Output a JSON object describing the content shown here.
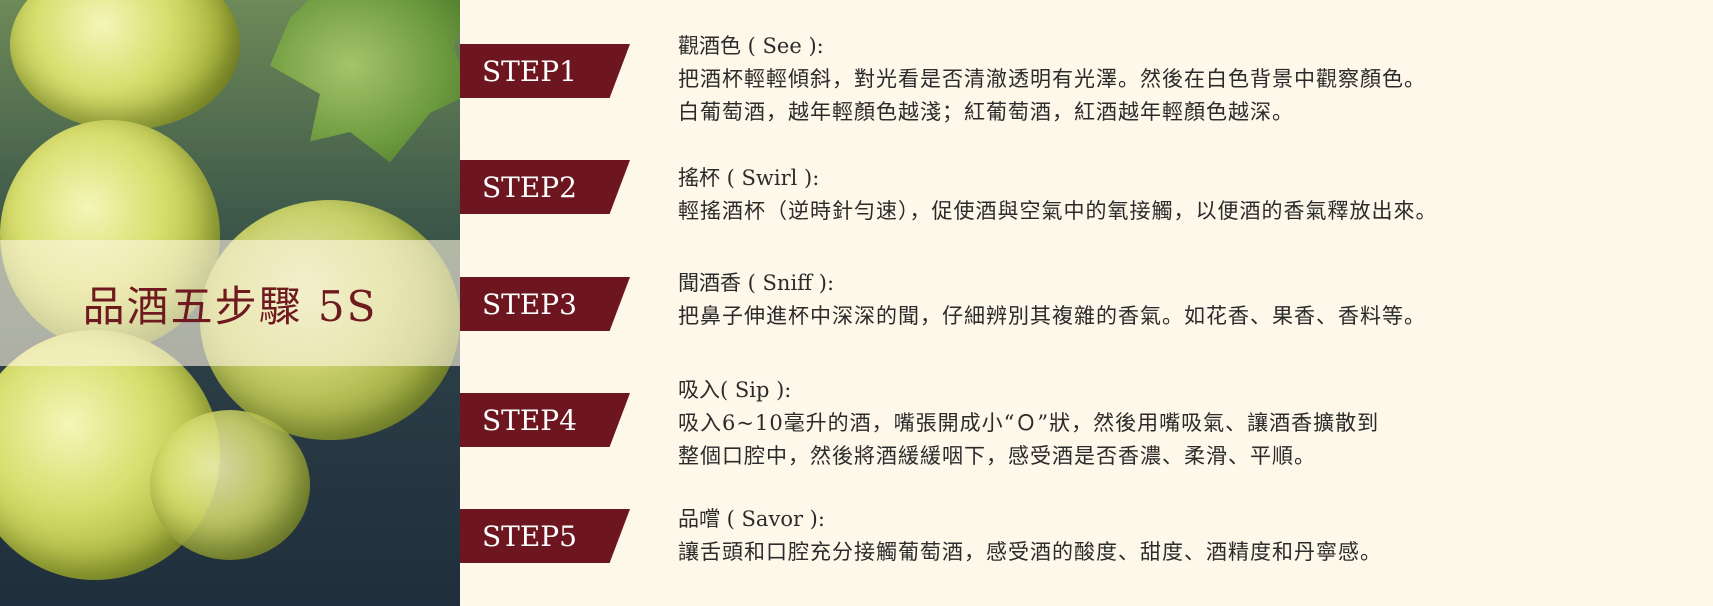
{
  "hero": {
    "title": "品酒五步驟 5S"
  },
  "steps": [
    {
      "tag": "STEP1",
      "heading": "觀酒色 ( See ):",
      "lines": [
        "把酒杯輕輕傾斜，對光看是否清澈透明有光澤。然後在白色背景中觀察顏色。",
        "白葡萄酒，越年輕顏色越淺；紅葡萄酒，紅酒越年輕顏色越深。"
      ]
    },
    {
      "tag": "STEP2",
      "heading": "搖杯 ( Swirl ):",
      "lines": [
        "輕搖酒杯（逆時針勻速），促使酒與空氣中的氧接觸，以便酒的香氣釋放出來。"
      ]
    },
    {
      "tag": "STEP3",
      "heading": "聞酒香 ( Sniff ):",
      "lines": [
        "把鼻子伸進杯中深深的聞，仔細辨別其複雜的香氣。如花香、果香、香料等。"
      ]
    },
    {
      "tag": "STEP4",
      "heading": "吸入( Sip ):",
      "lines": [
        "吸入6~10毫升的酒，嘴張開成小“Ｏ”狀，然後用嘴吸氣、讓酒香擴散到",
        "整個口腔中，然後將酒緩緩咽下，感受酒是否香濃、柔滑、平順。"
      ]
    },
    {
      "tag": "STEP5",
      "heading": "品嚐 ( Savor ):",
      "lines": [
        "讓舌頭和口腔充分接觸葡萄酒，感受酒的酸度、甜度、酒精度和丹寧感。"
      ]
    }
  ],
  "colors": {
    "background": "#fdf8e9",
    "step_tag": "#6d1620",
    "title": "#6f1a1f"
  }
}
